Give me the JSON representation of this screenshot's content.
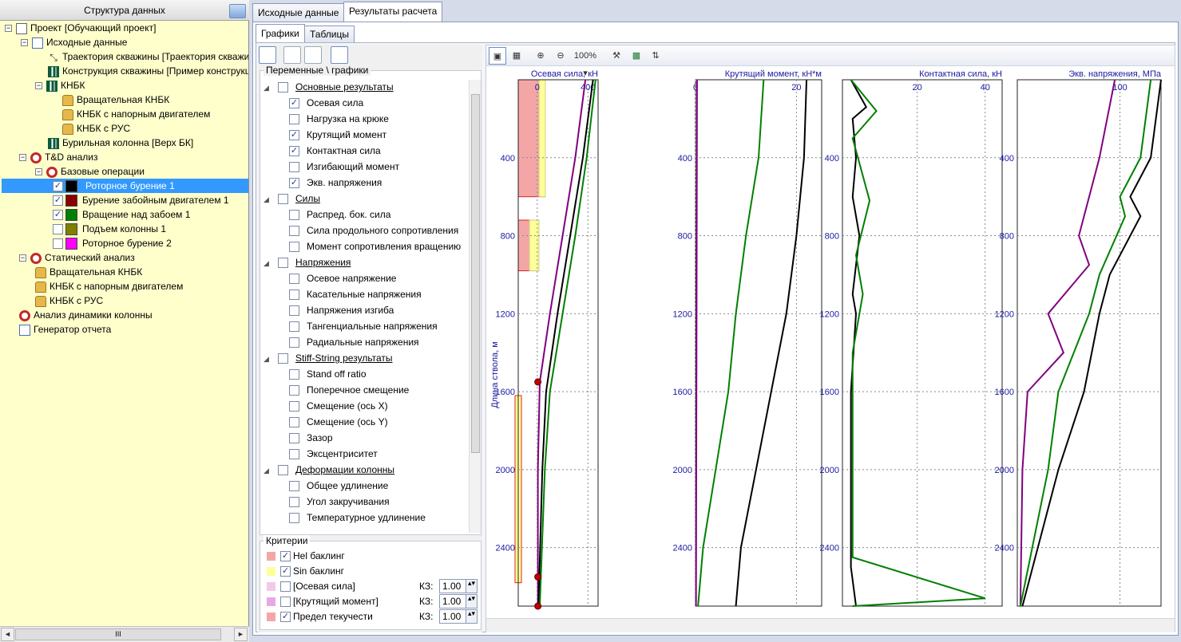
{
  "left_panel": {
    "title": "Структура данных",
    "tree": [
      {
        "label": "Проект [Обучающий проект]",
        "icon": "document-icon",
        "exp": "−",
        "checked": null,
        "swatch": null
      },
      {
        "label": "Исходные данные",
        "icon": "data-icon",
        "exp": "−",
        "checked": null,
        "swatch": null
      },
      {
        "label": "Траектория скважины [Траектория скважины]",
        "icon": "trajectory-icon",
        "exp": null,
        "checked": null,
        "swatch": null
      },
      {
        "label": "Конструкция скважины [Пример конструкции]",
        "icon": "casing-icon",
        "exp": null,
        "checked": null,
        "swatch": null
      },
      {
        "label": "КНБК",
        "icon": "bha-icon",
        "exp": "−",
        "checked": null,
        "swatch": null
      },
      {
        "label": "Вращательная КНБК",
        "icon": "lock-icon",
        "exp": null,
        "checked": null,
        "swatch": null
      },
      {
        "label": "КНБК с напорным двигателем",
        "icon": "lock-icon",
        "exp": null,
        "checked": null,
        "swatch": null
      },
      {
        "label": "КНБК с РУС",
        "icon": "lock-icon",
        "exp": null,
        "checked": null,
        "swatch": null
      },
      {
        "label": "Бурильная колонна [Верх БК]",
        "icon": "bha-icon",
        "exp": null,
        "checked": null,
        "swatch": null
      },
      {
        "label": "T&D анализ",
        "icon": "analysis-icon",
        "exp": "−",
        "checked": null,
        "swatch": null
      },
      {
        "label": "Базовые операции",
        "icon": "analysis-icon",
        "exp": "−",
        "checked": null,
        "swatch": null
      },
      {
        "label": "Роторное бурение 1",
        "icon": null,
        "exp": null,
        "checked": true,
        "swatch": "#000000",
        "selected": true
      },
      {
        "label": "Бурение забойным двигателем 1",
        "icon": null,
        "exp": null,
        "checked": true,
        "swatch": "#8b0000"
      },
      {
        "label": "Вращение над забоем 1",
        "icon": null,
        "exp": null,
        "checked": true,
        "swatch": "#008000"
      },
      {
        "label": "Подъем колонны 1",
        "icon": null,
        "exp": null,
        "checked": false,
        "swatch": "#808000"
      },
      {
        "label": "Роторное бурение 2",
        "icon": null,
        "exp": null,
        "checked": false,
        "swatch": "#ff00ff"
      },
      {
        "label": "Статический анализ",
        "icon": "analysis-icon",
        "exp": "−",
        "checked": null,
        "swatch": null
      },
      {
        "label": "Вращательная КНБК",
        "icon": "lock-icon",
        "exp": null,
        "checked": null,
        "swatch": null
      },
      {
        "label": "КНБК с напорным двигателем",
        "icon": "lock-icon",
        "exp": null,
        "checked": null,
        "swatch": null
      },
      {
        "label": "КНБК с РУС",
        "icon": "lock-icon",
        "exp": null,
        "checked": null,
        "swatch": null
      },
      {
        "label": "Анализ динамики колонны",
        "icon": "analysis-icon",
        "exp": null,
        "checked": null,
        "swatch": null
      },
      {
        "label": "Генератор отчета",
        "icon": "report-icon",
        "exp": null,
        "checked": null,
        "swatch": null
      }
    ],
    "scroll_thumb": "III"
  },
  "tabs": {
    "main": [
      "Исходные данные",
      "Результаты расчета"
    ],
    "main_active": 1,
    "sub": [
      "Графики",
      "Таблицы"
    ],
    "sub_active": 0
  },
  "variables": {
    "title": "Переменные \\ графики",
    "rows": [
      {
        "type": "cat",
        "label": "Основные результаты",
        "checked": false
      },
      {
        "type": "item",
        "label": "Осевая сила",
        "checked": true
      },
      {
        "type": "item",
        "label": "Нагрузка на крюке",
        "checked": false
      },
      {
        "type": "item",
        "label": "Крутящий момент",
        "checked": true
      },
      {
        "type": "item",
        "label": "Контактная сила",
        "checked": true
      },
      {
        "type": "item",
        "label": "Изгибающий момент",
        "checked": false
      },
      {
        "type": "item",
        "label": "Экв. напряжения",
        "checked": true
      },
      {
        "type": "cat",
        "label": "Силы",
        "checked": false
      },
      {
        "type": "item",
        "label": "Распред. бок. сила",
        "checked": false
      },
      {
        "type": "item",
        "label": "Сила продольного сопротивления",
        "checked": false
      },
      {
        "type": "item",
        "label": "Момент сопротивления вращению",
        "checked": false
      },
      {
        "type": "cat",
        "label": "Напряжения",
        "checked": false
      },
      {
        "type": "item",
        "label": "Осевое напряжение",
        "checked": false
      },
      {
        "type": "item",
        "label": "Касательные напряжения",
        "checked": false
      },
      {
        "type": "item",
        "label": "Напряжения изгиба",
        "checked": false
      },
      {
        "type": "item",
        "label": "Тангенциальные напряжения",
        "checked": false
      },
      {
        "type": "item",
        "label": "Радиальные напряжения",
        "checked": false
      },
      {
        "type": "cat",
        "label": "Stiff-String результаты",
        "checked": false
      },
      {
        "type": "item",
        "label": "Stand off ratio",
        "checked": false
      },
      {
        "type": "item",
        "label": "Поперечное смещение",
        "checked": false
      },
      {
        "type": "item",
        "label": "Смещение (ось X)",
        "checked": false
      },
      {
        "type": "item",
        "label": "Смещение (ось Y)",
        "checked": false
      },
      {
        "type": "item",
        "label": "Зазор",
        "checked": false
      },
      {
        "type": "item",
        "label": "Эксцентриситет",
        "checked": false
      },
      {
        "type": "cat",
        "label": "Деформации колонны",
        "checked": false
      },
      {
        "type": "item",
        "label": "Общее удлинение",
        "checked": false
      },
      {
        "type": "item",
        "label": "Угол закручивания",
        "checked": false
      },
      {
        "type": "item",
        "label": "Температурное удлинение",
        "checked": false
      }
    ]
  },
  "criteria": {
    "title": "Критерии",
    "kz_label": "КЗ:",
    "rows": [
      {
        "label": "Hel баклинг",
        "checked": true,
        "color": "#f4a6a6",
        "kz": null
      },
      {
        "label": "Sin баклинг",
        "checked": true,
        "color": "#ffff99",
        "kz": null
      },
      {
        "label": "[Осевая сила]",
        "checked": false,
        "color": "#f4c8e8",
        "kz": "1.00"
      },
      {
        "label": "[Крутящий момент]",
        "checked": false,
        "color": "#e8a8e8",
        "kz": "1.00"
      },
      {
        "label": "Предел текучести",
        "checked": true,
        "color": "#f4a6a6",
        "kz": "1.00"
      }
    ]
  },
  "chart_toolbar": {
    "zoom_label": "100%"
  },
  "chart_data": [
    {
      "type": "line",
      "title": "Осевая сила, кН",
      "xlim": [
        -150,
        480
      ],
      "x_ticks": [
        0,
        400
      ],
      "ylim": [
        0,
        2700
      ],
      "y_ticks": [
        400,
        800,
        1200,
        1600,
        2000,
        2400
      ],
      "ylabel": "Длина ствола, м",
      "series": [
        {
          "color": "#800080",
          "x": [
            380,
            300,
            200,
            100,
            20,
            5,
            5
          ],
          "y": [
            0,
            400,
            800,
            1200,
            1550,
            2000,
            2700
          ]
        },
        {
          "color": "#000000",
          "x": [
            440,
            360,
            260,
            160,
            70,
            40,
            10
          ],
          "y": [
            0,
            400,
            800,
            1200,
            1600,
            2000,
            2700
          ]
        },
        {
          "color": "#008000",
          "x": [
            460,
            390,
            300,
            200,
            100,
            60,
            20
          ],
          "y": [
            0,
            400,
            800,
            1200,
            1600,
            2000,
            2700
          ]
        }
      ],
      "markers": [
        {
          "x": 5,
          "y": 1550
        },
        {
          "x": 5,
          "y": 2550
        },
        {
          "x": 5,
          "y": 2700
        }
      ]
    },
    {
      "type": "line",
      "title": "Крутящий момент, кН*м",
      "xlim": [
        0,
        25
      ],
      "x_ticks": [
        0,
        20
      ],
      "ylim": [
        0,
        2700
      ],
      "y_ticks": [
        400,
        800,
        1200,
        1600,
        2000,
        2400
      ],
      "series": [
        {
          "color": "#800080",
          "x": [
            0.3,
            0.2,
            0.1
          ],
          "y": [
            0,
            1400,
            2700
          ]
        },
        {
          "color": "#000000",
          "x": [
            22,
            21.5,
            20,
            18,
            15,
            12,
            9,
            8
          ],
          "y": [
            0,
            400,
            800,
            1200,
            1600,
            2000,
            2400,
            2700
          ]
        },
        {
          "color": "#008000",
          "x": [
            13.5,
            12.5,
            10,
            8,
            6.5,
            4,
            1.5,
            0.5
          ],
          "y": [
            0,
            400,
            800,
            1200,
            1600,
            2000,
            2400,
            2700
          ]
        }
      ]
    },
    {
      "type": "line",
      "title": "Контактная сила, кН",
      "xlim": [
        -2,
        45
      ],
      "x_ticks": [
        20,
        40
      ],
      "ylim": [
        0,
        2700
      ],
      "y_ticks": [
        400,
        800,
        1200,
        1600,
        2000,
        2400
      ],
      "series": [
        {
          "color": "#000000",
          "x": [
            0.5,
            5,
            1,
            2,
            1,
            3,
            1,
            2,
            0.5,
            0.5,
            2
          ],
          "y": [
            0,
            140,
            200,
            400,
            600,
            800,
            1100,
            1200,
            1600,
            2500,
            2700
          ]
        },
        {
          "color": "#008000",
          "x": [
            0.5,
            8,
            1,
            6,
            2,
            4,
            1,
            1,
            40,
            1
          ],
          "y": [
            0,
            160,
            300,
            620,
            900,
            1100,
            1400,
            2450,
            2660,
            2700
          ]
        }
      ]
    },
    {
      "type": "line",
      "title": "Экв. напряжения, МПа",
      "xlim": [
        0,
        140
      ],
      "x_ticks": [
        100
      ],
      "ylim": [
        0,
        2700
      ],
      "y_ticks": [
        400,
        800,
        1200,
        1600,
        2000,
        2400
      ],
      "series": [
        {
          "color": "#800080",
          "x": [
            95,
            80,
            60,
            70,
            30,
            45,
            10,
            5,
            3
          ],
          "y": [
            0,
            400,
            800,
            950,
            1200,
            1400,
            1600,
            2000,
            2700
          ]
        },
        {
          "color": "#000000",
          "x": [
            140,
            130,
            110,
            120,
            90,
            80,
            65,
            40,
            5
          ],
          "y": [
            0,
            400,
            600,
            700,
            1000,
            1200,
            1600,
            2000,
            2700
          ]
        },
        {
          "color": "#008000",
          "x": [
            130,
            120,
            100,
            105,
            80,
            70,
            40,
            30,
            3
          ],
          "y": [
            0,
            400,
            600,
            700,
            1000,
            1200,
            1600,
            2000,
            2700
          ]
        }
      ]
    }
  ]
}
